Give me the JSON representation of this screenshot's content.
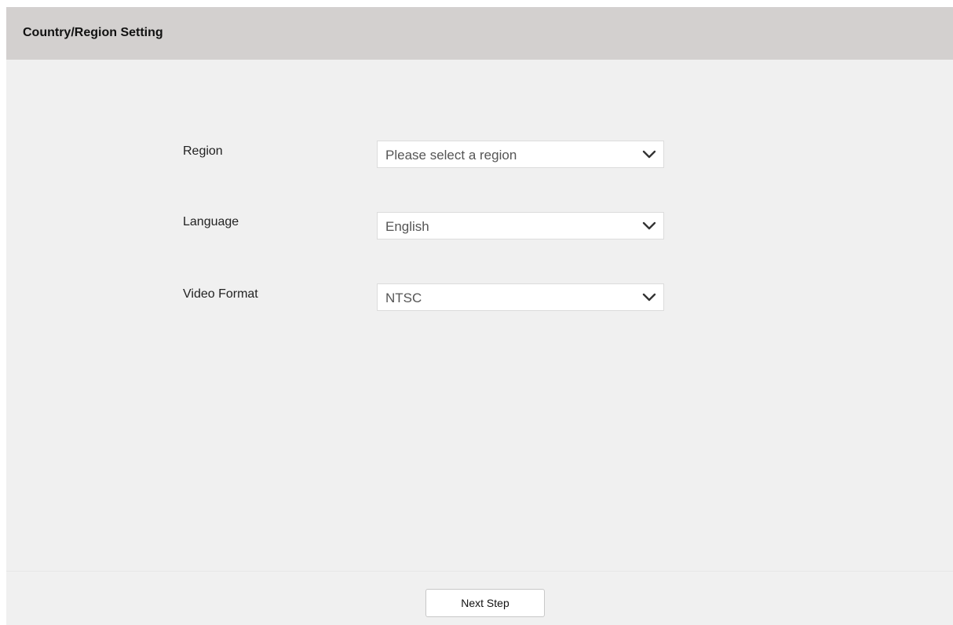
{
  "header": {
    "title": "Country/Region Setting"
  },
  "form": {
    "region": {
      "label": "Region",
      "value": "Please select a region"
    },
    "language": {
      "label": "Language",
      "value": "English"
    },
    "video_format": {
      "label": "Video Format",
      "value": "NTSC"
    }
  },
  "footer": {
    "next_label": "Next Step"
  },
  "icons": {
    "dropdown": "chevron-down-icon"
  },
  "colors": {
    "header_bg": "#d3d0cf",
    "page_bg": "#f0f0f0",
    "field_bg": "#ffffff"
  }
}
